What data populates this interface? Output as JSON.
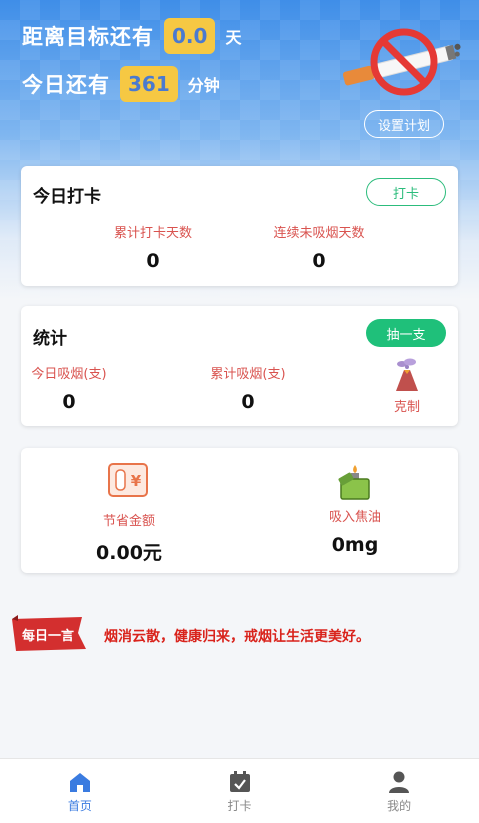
{
  "header": {
    "goal_label": "距离目标还有",
    "goal_days": "0.0",
    "goal_unit": "天",
    "today_label": "今日还有",
    "today_minutes": "361",
    "today_unit": "分钟",
    "plan_button": "设置计划"
  },
  "checkin": {
    "title": "今日打卡",
    "button": "打卡",
    "total_days_label": "累计打卡天数",
    "total_days_value": "0",
    "streak_label": "连续未吸烟天数",
    "streak_value": "0"
  },
  "stats": {
    "title": "统计",
    "button": "抽一支",
    "today_label": "今日吸烟(支)",
    "today_value": "0",
    "total_label": "累计吸烟(支)",
    "total_value": "0",
    "restrain_label": "克制"
  },
  "savings": {
    "money_label": "节省金额",
    "money_value": "0.00元",
    "tar_label": "吸入焦油",
    "tar_value": "0mg"
  },
  "quote": {
    "badge": "每日一言",
    "text": "烟消云散，健康归来，戒烟让生活更美好。"
  },
  "tabbar": {
    "items": [
      {
        "label": "首页",
        "icon": "home-icon"
      },
      {
        "label": "打卡",
        "icon": "calendar-check-icon"
      },
      {
        "label": "我的",
        "icon": "user-icon"
      }
    ]
  },
  "colors": {
    "accent": "#3a7be0",
    "green": "#1fc07a",
    "red": "#d9534f",
    "pill": "#f6c843"
  }
}
